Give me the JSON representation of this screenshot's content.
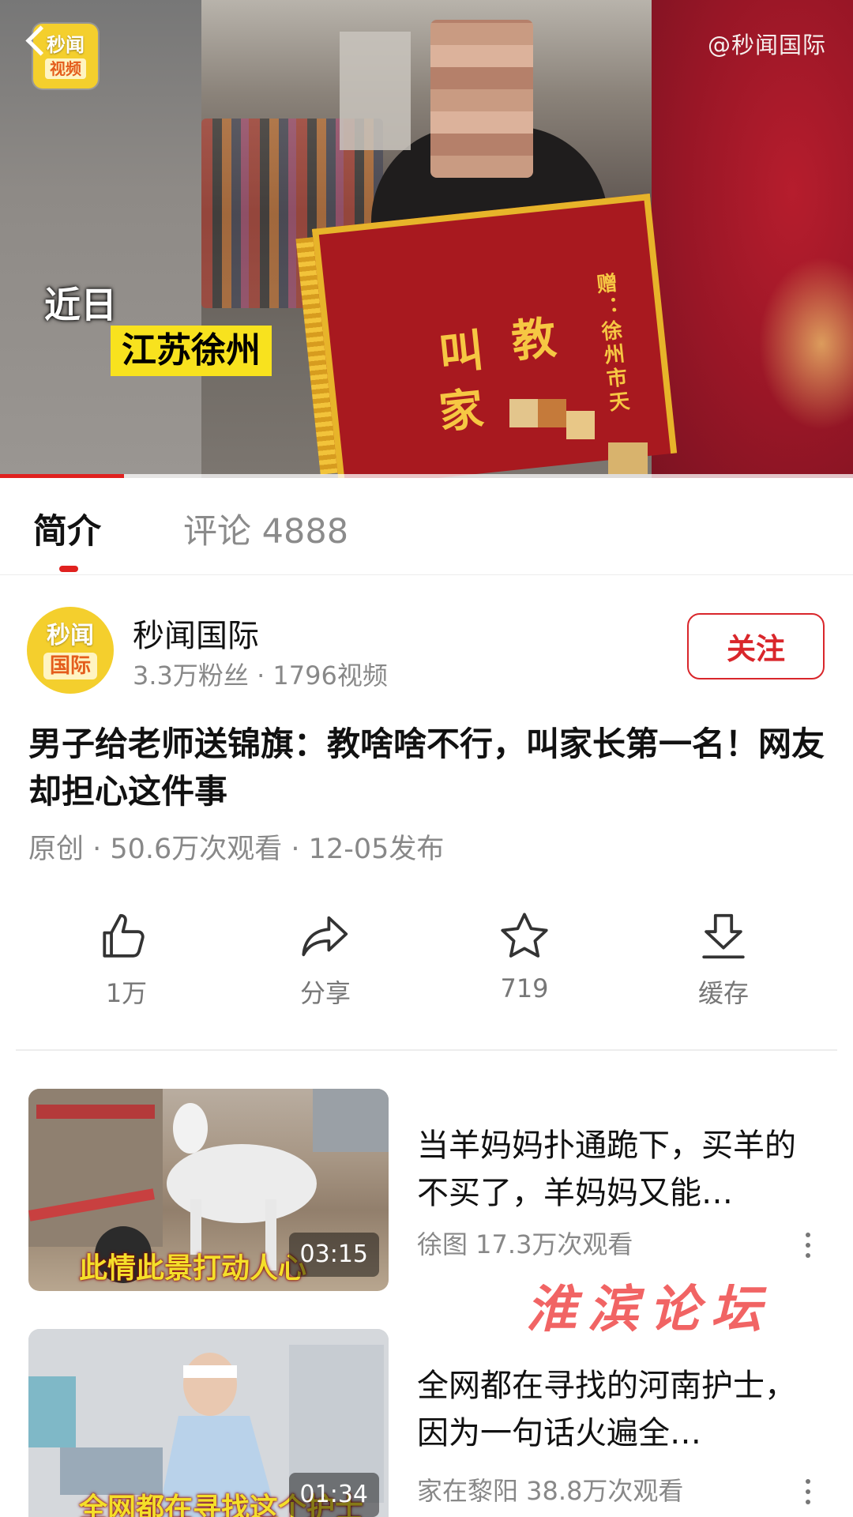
{
  "player": {
    "channel_watermark": "@秒闻国际",
    "logo_line1": "秒闻",
    "logo_line2": "视频",
    "caption_line1": "近日",
    "caption_line2": "江苏徐州",
    "banner_text_1": "教",
    "banner_text_2": "叫",
    "banner_text_3": "家",
    "banner_small_text": "赠：徐州市天",
    "progress_fraction": 0.145,
    "accent_color": "#e0211f"
  },
  "tabs": {
    "intro": "简介",
    "comments": "评论 4888"
  },
  "channel": {
    "avatar_line1": "秒闻",
    "avatar_line2": "国际",
    "name": "秒闻国际",
    "stats": "3.3万粉丝 · 1796视频",
    "follow_label": "关注",
    "follow_color": "#d9262b"
  },
  "video": {
    "title": "男子给老师送锦旗：教啥啥不行，叫家长第一名！网友却担心这件事",
    "meta": "原创 · 50.6万次观看 · 12-05发布"
  },
  "actions": [
    {
      "icon": "thumbs-up-icon",
      "label": "1万"
    },
    {
      "icon": "share-icon",
      "label": "分享"
    },
    {
      "icon": "star-icon",
      "label": "719"
    },
    {
      "icon": "download-icon",
      "label": "缓存"
    }
  ],
  "recommendations": [
    {
      "title": "当羊妈妈扑通跪下，买羊的不买了，羊妈妈又能…",
      "meta": "徐图   17.3万次观看",
      "duration": "03:15",
      "thumb_caption": "此情此景打动人心"
    },
    {
      "title": "全网都在寻找的河南护士，因为一句话火遍全…",
      "meta": "家在黎阳   38.8万次观看",
      "duration": "01:34",
      "thumb_caption": "全网都在寻找这个护士"
    }
  ],
  "site_watermark": "淮滨论坛"
}
